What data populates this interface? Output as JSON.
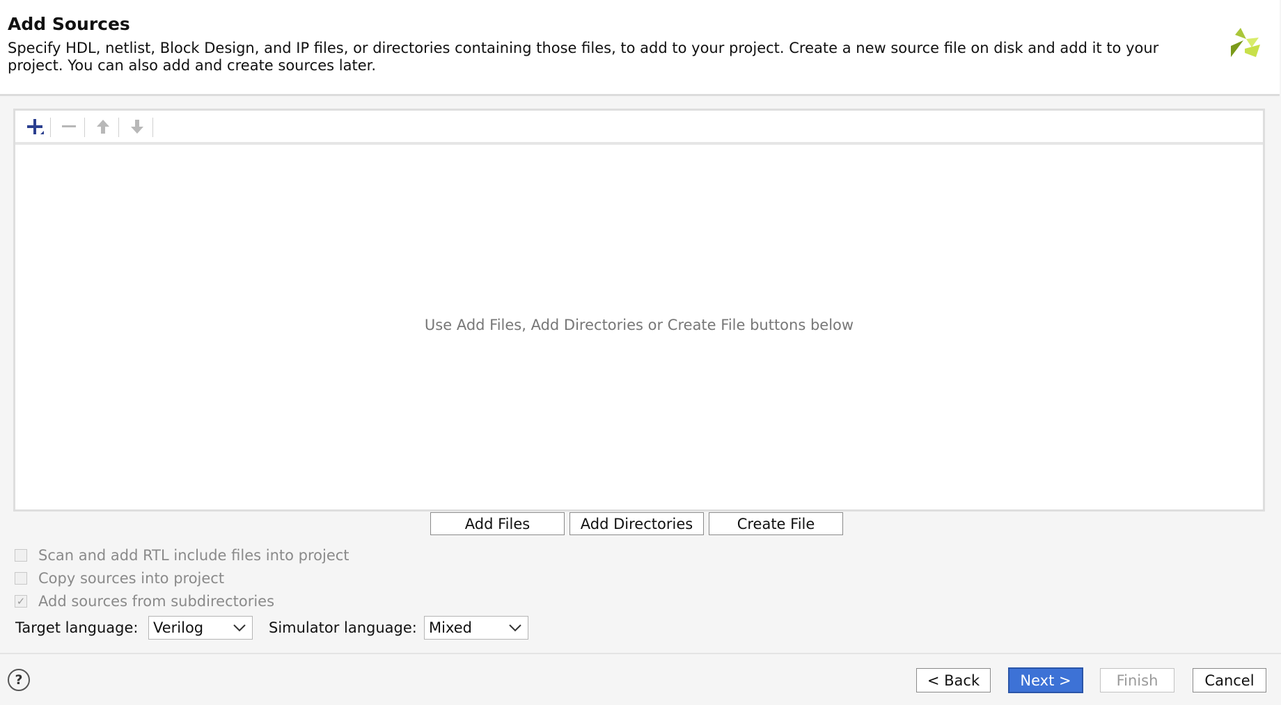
{
  "header": {
    "title": "Add Sources",
    "description": "Specify HDL, netlist, Block Design, and IP files, or directories containing those files, to add to your project. Create a new source file on disk and add it to your project. You can also add and create sources later."
  },
  "panel": {
    "empty_message": "Use Add Files, Add Directories or Create File buttons below"
  },
  "action_buttons": {
    "add_files": "Add Files",
    "add_directories": "Add Directories",
    "create_file": "Create File"
  },
  "options": {
    "scan_rtl": {
      "label": "Scan and add RTL include files into project",
      "checked": false
    },
    "copy_sources": {
      "label": "Copy sources into project",
      "checked": false
    },
    "add_subdirs": {
      "label": "Add sources from subdirectories",
      "checked": true
    }
  },
  "languages": {
    "target_label": "Target language:",
    "target_value": "Verilog",
    "simulator_label": "Simulator language:",
    "simulator_value": "Mixed"
  },
  "footer": {
    "help": "?",
    "back": "< Back",
    "next": "Next >",
    "finish": "Finish",
    "cancel": "Cancel"
  },
  "colors": {
    "accent": "#3d72d6",
    "logo_dark": "#7a9a1a",
    "logo_light": "#c8e04a"
  }
}
